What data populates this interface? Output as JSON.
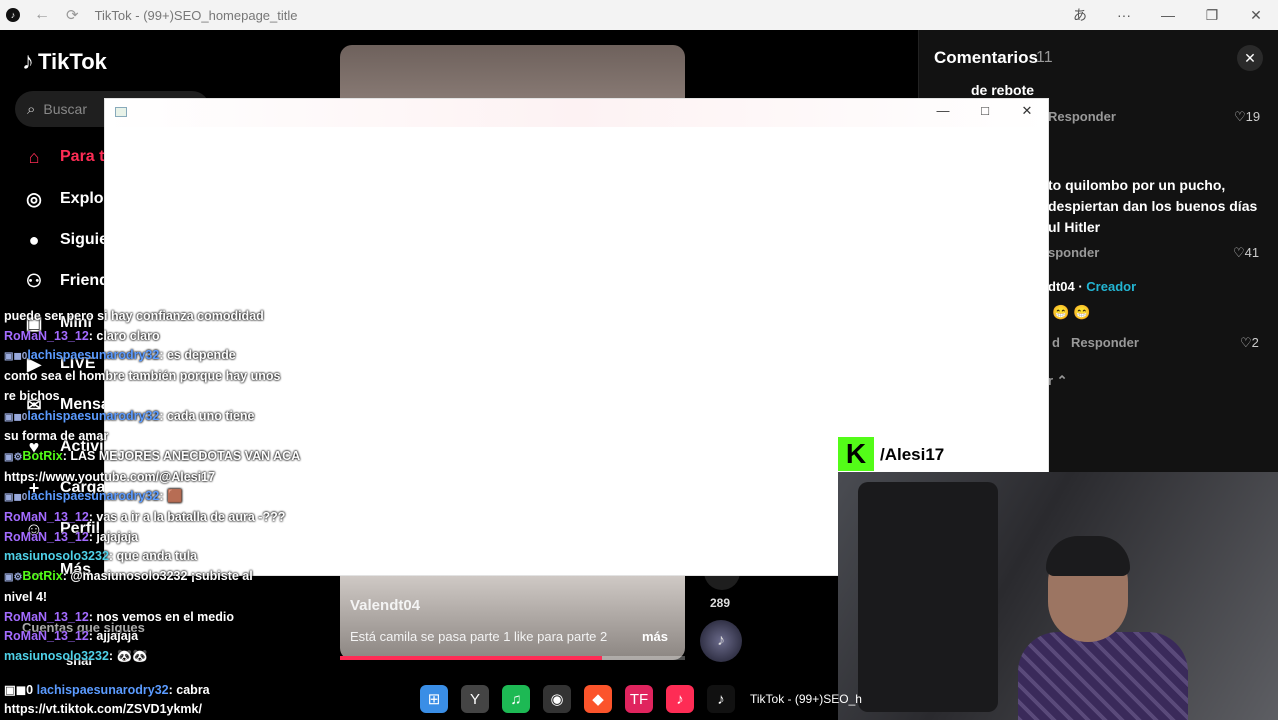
{
  "browser": {
    "title": "TikTok - (99+)SEO_homepage_title",
    "back_icon": "←",
    "reload_icon": "⟳",
    "translate_icon": "あ",
    "menu_icon": "···",
    "min_icon": "—",
    "max_icon": "❐",
    "close_icon": "✕"
  },
  "sidebar": {
    "logo": "TikTok",
    "search_placeholder": "Buscar",
    "items": [
      {
        "label": "Para ti",
        "icon": "⌂"
      },
      {
        "label": "Explorar",
        "icon": "◎"
      },
      {
        "label": "Siguiendo",
        "icon": "●"
      },
      {
        "label": "Friends",
        "icon": "⚇"
      },
      {
        "label": "Mini",
        "icon": "▣"
      },
      {
        "label": "LIVE",
        "icon": "▶"
      },
      {
        "label": "Mensajes",
        "icon": "✉"
      },
      {
        "label": "Actividad",
        "icon": "♥"
      },
      {
        "label": "Cargar",
        "icon": "+"
      },
      {
        "label": "Perfil",
        "icon": "☺"
      },
      {
        "label": "Más",
        "icon": "…"
      }
    ],
    "following_header": "Cuentas que sigues",
    "following_user": "shai"
  },
  "video": {
    "author": "Valendt04",
    "description": "Está camila se pasa parte 1 like para parte 2",
    "more": "más",
    "share_count": "289",
    "progress": 0.76
  },
  "comments": {
    "title": "Comentarios",
    "count": "11",
    "items": [
      {
        "text": "de rebote"
      },
      {
        "action": "Responder",
        "likes": "19"
      },
      {
        "text_lines": [
          "to quilombo por un pucho,",
          "despiertan dan los buenos días",
          "ul Hitler"
        ]
      },
      {
        "action": "sponder",
        "likes": "41"
      },
      {
        "author": "dt04",
        "creator_label": "Creador"
      },
      {
        "text": "😁 😁"
      },
      {
        "date": "d",
        "action": "Responder",
        "likes": "2"
      },
      {
        "expand": "r ⌃"
      }
    ]
  },
  "streamer": {
    "kick_letter": "K",
    "handle": "/Alesi17"
  },
  "chat": [
    {
      "text": "puede ser pero si hay confianza comodidad"
    },
    {
      "user": "RoMaN_13_12",
      "text": "claro claro",
      "color": "rom"
    },
    {
      "user": "lachispaesunarodry32",
      "text": "es depende",
      "color": "lac",
      "badges": "▣◼0"
    },
    {
      "text": "como sea el hombre también porque hay unos"
    },
    {
      "text": "re bichos"
    },
    {
      "user": "lachispaesunarodry32",
      "text": "cada uno tiene",
      "color": "lac",
      "badges": "▣◼0"
    },
    {
      "text": "su forma de amar"
    },
    {
      "user": "BotRix",
      "text": "LAS MEJORES ANECDOTAS VAN ACA",
      "color": "bot",
      "badges": "▣⚙"
    },
    {
      "text": "https://www.youtube.com/@Alesi17"
    },
    {
      "user": "lachispaesunarodry32",
      "text": "🟫",
      "color": "lac",
      "badges": "▣◼0"
    },
    {
      "user": "RoMaN_13_12",
      "text": "vas a ir a la batalla de aura -???",
      "color": "rom"
    },
    {
      "user": "RoMaN_13_12",
      "text": "jajajaja",
      "color": "rom"
    },
    {
      "user": "masiunosolo3232",
      "text": "que anda tula",
      "color": "mas"
    },
    {
      "user": "BotRix",
      "text": "@masiunosolo3232 ¡subiste al",
      "color": "bot",
      "badges": "▣⚙"
    },
    {
      "text": "nivel 4!"
    },
    {
      "user": "RoMaN_13_12",
      "text": "nos vemos en el medio",
      "color": "rom"
    },
    {
      "user": "RoMaN_13_12",
      "text": "ajjajaja",
      "color": "rom"
    },
    {
      "user": "masiunosolo3232",
      "text": "🐼🐼",
      "color": "mas"
    }
  ],
  "chat_last": {
    "user": "lachispaesunarodry32",
    "text": "cabra",
    "badges": "▣◼0",
    "link": "https://vt.tiktok.com/ZSVD1ykmk/"
  },
  "taskbar": {
    "items": [
      {
        "name": "windows",
        "glyph": "⊞",
        "color": "#3a8ee6"
      },
      {
        "name": "yandex",
        "glyph": "Y",
        "color": "#444"
      },
      {
        "name": "spotify",
        "glyph": "♫",
        "color": "#1db954"
      },
      {
        "name": "obs",
        "glyph": "◉",
        "color": "#333"
      },
      {
        "name": "brave",
        "glyph": "◆",
        "color": "#fb542b"
      },
      {
        "name": "tf",
        "glyph": "TF",
        "color": "#e0245e"
      },
      {
        "name": "tiktok-app",
        "glyph": "♪",
        "color": "#fe2c55"
      },
      {
        "name": "tiktok-window",
        "glyph": "♪",
        "color": "#111"
      }
    ],
    "active_label": "TikTok - (99+)SEO_h"
  }
}
